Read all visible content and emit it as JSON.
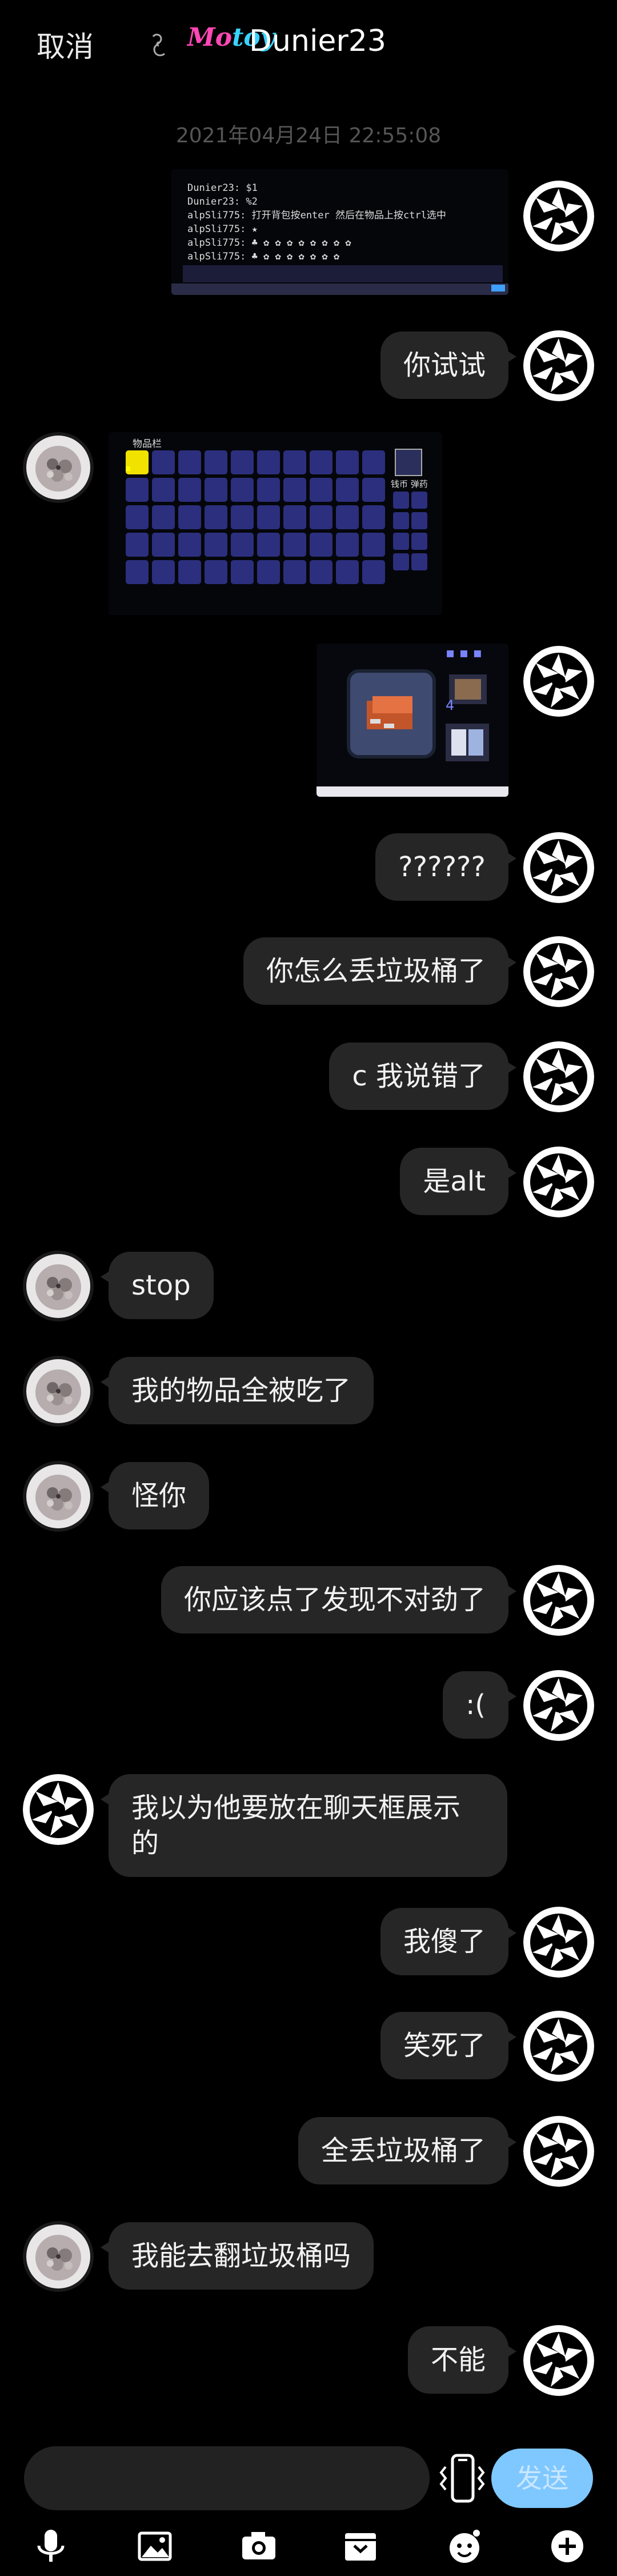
{
  "header": {
    "cancel_label": "取消",
    "logo_part1": "Mo",
    "logo_part2": "toy",
    "title": "Dunier23"
  },
  "timestamp": "2021年04月24日 22:55:08",
  "shot1": {
    "lines": [
      "Dunier23: $1",
      "Dunier23: %2",
      "alpSli775: 打开背包按enter 然后在物品上按ctrl选中",
      "alpSli775: ★",
      "alpSli775: ♣ ✿ ✿ ✿ ✿ ✿ ✿ ✿ ✿"
    ]
  },
  "shot2": {
    "inventory_label": "物品栏",
    "coins_label": "钱币 弹药"
  },
  "messages": [
    {
      "side": "right",
      "text": "你试试"
    },
    {
      "side": "right",
      "text": "??????"
    },
    {
      "side": "right",
      "text": "你怎么丢垃圾桶了"
    },
    {
      "side": "right",
      "text": "c 我说错了"
    },
    {
      "side": "right",
      "text": "是alt"
    },
    {
      "side": "left",
      "text": "stop"
    },
    {
      "side": "left",
      "text": "我的物品全被吃了"
    },
    {
      "side": "left",
      "text": "怪你"
    },
    {
      "side": "right",
      "text": "你应该点了发现不对劲了"
    },
    {
      "side": "right",
      "text": ":("
    },
    {
      "side": "left",
      "text": "我以为他要放在聊天框展示的"
    },
    {
      "side": "right",
      "text": "我傻了"
    },
    {
      "side": "right",
      "text": "笑死了"
    },
    {
      "side": "right",
      "text": "全丢垃圾桶了"
    },
    {
      "side": "left",
      "text": "我能去翻垃圾桶吗"
    },
    {
      "side": "right",
      "text": "不能"
    }
  ],
  "composer": {
    "send_label": "发送"
  },
  "toolbar": {
    "icons": [
      "microphone-icon",
      "image-icon",
      "camera-icon",
      "gift-box-icon",
      "emoji-icon",
      "plus-icon"
    ]
  },
  "colors": {
    "bubble": "#262626",
    "send_button": "#7fc7ff",
    "timestamp": "#555555"
  }
}
